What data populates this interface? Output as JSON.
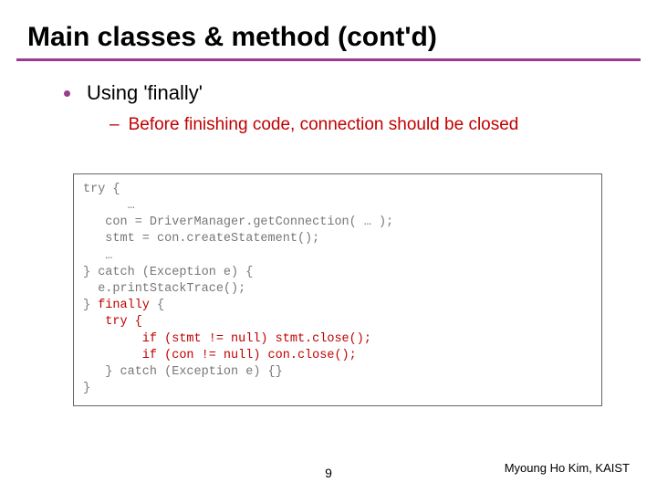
{
  "title": "Main classes & method (cont'd)",
  "bullet": "Using 'finally'",
  "subbullet": "Before finishing code, connection should be closed",
  "code": {
    "l1": "try {",
    "l2": "      …",
    "l3": "   con = DriverManager.getConnection( … );",
    "l4": "   stmt = con.createStatement();",
    "l5": "   …",
    "l6": "} catch (Exception e) {",
    "l7": "  e.printStackTrace();",
    "l8a": "} ",
    "l8b": "finally",
    "l8c": " {",
    "l9": "   try {",
    "l10": "        if (stmt != null) stmt.close();",
    "l11": "        if (con != null) con.close();",
    "l12": "   } catch (Exception e) {}",
    "l13": "}"
  },
  "page_number": "9",
  "credit": "Myoung Ho Kim, KAIST"
}
